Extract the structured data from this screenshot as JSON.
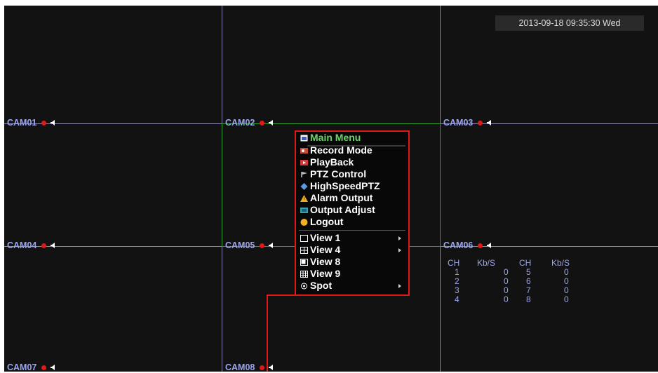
{
  "datetime": "2013-09-18 09:35:30 Wed",
  "cameras": [
    "CAM01",
    "CAM02",
    "CAM03",
    "CAM04",
    "CAM05",
    "CAM06",
    "CAM07",
    "CAM08"
  ],
  "stats": {
    "headers": [
      "CH",
      "Kb/S",
      "CH",
      "Kb/S"
    ],
    "rows": [
      [
        "1",
        "0",
        "5",
        "0"
      ],
      [
        "2",
        "0",
        "6",
        "0"
      ],
      [
        "3",
        "0",
        "7",
        "0"
      ],
      [
        "4",
        "0",
        "8",
        "0"
      ]
    ]
  },
  "menu": {
    "title": "Main Menu",
    "items": [
      "Record Mode",
      "PlayBack",
      "PTZ Control",
      "HighSpeedPTZ",
      "Alarm Output",
      "Output Adjust",
      "Logout"
    ],
    "views": [
      "View 1",
      "View 4",
      "View 8",
      "View 9",
      "Spot"
    ]
  },
  "colors": {
    "grid": "#8f86b4",
    "cam_label": "#9aa4ee",
    "record_dot": "#e01818",
    "menu_border": "#e01818",
    "menu_title": "#6cd36c",
    "selected_cell": "#2fa02f"
  },
  "icons": {
    "main_menu": "window-icon",
    "record_mode": "record-icon",
    "playback": "playback-icon",
    "ptz_control": "ptz-icon",
    "high_speed_ptz": "diamond-icon",
    "alarm_output": "warning-icon",
    "output_adjust": "monitor-icon",
    "logout": "smiley-icon"
  }
}
